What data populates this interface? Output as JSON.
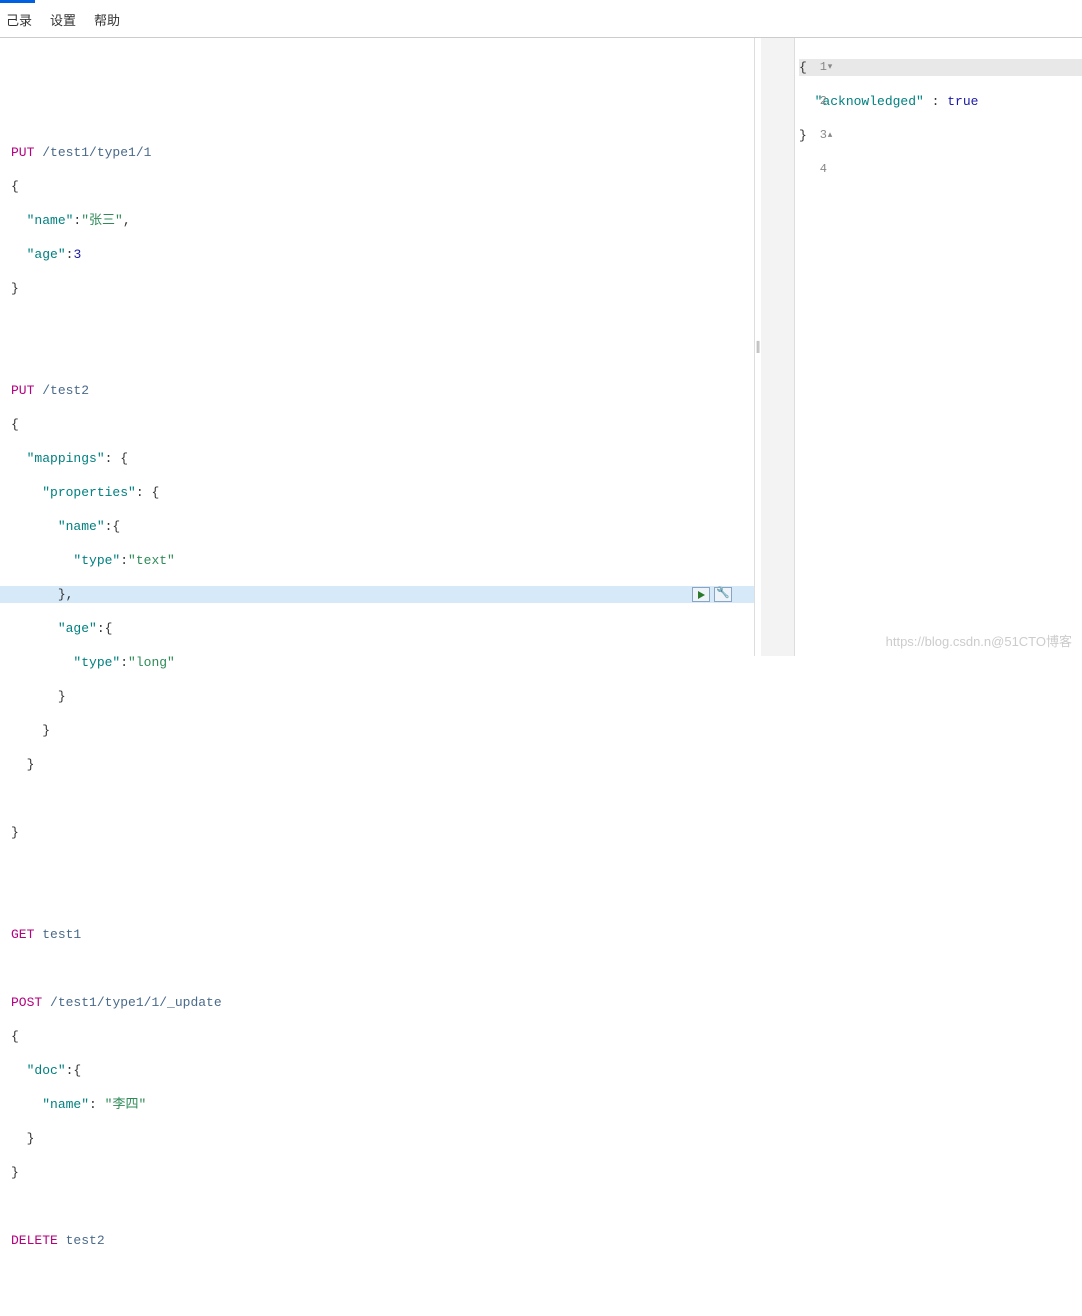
{
  "menu": {
    "history": "己录",
    "settings": "设置",
    "help": "帮助"
  },
  "editor": {
    "req1": {
      "method": "PUT",
      "path": "/test1/type1/1"
    },
    "req1_body": {
      "open": "{",
      "name_key": "\"name\"",
      "name_val": "\"张三\"",
      "age_key": "\"age\"",
      "age_val": "3",
      "close": "}"
    },
    "req2": {
      "method": "PUT",
      "path": "/test2"
    },
    "req2_body": {
      "open": "{",
      "mappings_key": "\"mappings\"",
      "properties_key": "\"properties\"",
      "name_key": "\"name\"",
      "type_key": "\"type\"",
      "text_val": "\"text\"",
      "age_key": "\"age\"",
      "long_val": "\"long\"",
      "close_brace": "}",
      "comma": ","
    },
    "req3": {
      "method": "GET",
      "path": "test1"
    },
    "req4": {
      "method": "POST",
      "path": "/test1/type1/1/_update"
    },
    "req4_body": {
      "open": "{",
      "doc_key": "\"doc\"",
      "name_key": "\"name\"",
      "name_val": "\"李四\"",
      "close": "}"
    },
    "req5": {
      "method": "DELETE",
      "path": "test2"
    }
  },
  "result": {
    "lines": [
      "1",
      "2",
      "3",
      "4"
    ],
    "l1": "{",
    "l2_key": "\"acknowledged\"",
    "l2_colon": " : ",
    "l2_val": "true",
    "l3": "}",
    "l4": ""
  },
  "watermark": "https://blog.csdn.n@51CTO博客"
}
